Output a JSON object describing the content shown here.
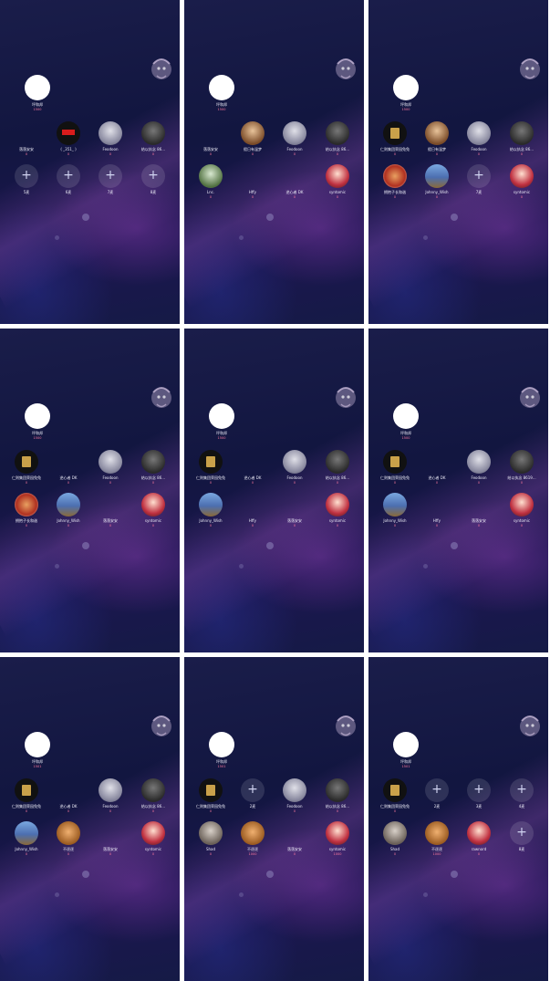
{
  "screens": [
    {
      "host": {
        "name": "坪和邦",
        "badge": "1500"
      },
      "seats": [
        {
          "name": "落落安安",
          "badge": "0",
          "avatar": "ghost",
          "empty": false
        },
        {
          "name": "( _351_ )",
          "badge": "0",
          "avatar": "red",
          "empty": false
        },
        {
          "name": "Feodoon",
          "badge": "0",
          "avatar": "silver",
          "empty": false
        },
        {
          "name": "结以执念 86...",
          "badge": "0",
          "avatar": "dark",
          "empty": false
        },
        {
          "name": "5麦",
          "badge": "",
          "avatar": "",
          "empty": true
        },
        {
          "name": "6麦",
          "badge": "",
          "avatar": "",
          "empty": true
        },
        {
          "name": "7麦",
          "badge": "",
          "avatar": "",
          "empty": true
        },
        {
          "name": "8麦",
          "badge": "",
          "avatar": "",
          "empty": true
        }
      ]
    },
    {
      "host": {
        "name": "坪和邦",
        "badge": "1500"
      },
      "seats": [
        {
          "name": "落落安安",
          "badge": "0",
          "avatar": "ghost",
          "empty": false
        },
        {
          "name": "假日有温梦",
          "badge": "0",
          "avatar": "brown",
          "empty": false
        },
        {
          "name": "Feodoon",
          "badge": "0",
          "avatar": "silver",
          "empty": false
        },
        {
          "name": "结以执念 86...",
          "badge": "0",
          "avatar": "dark",
          "empty": false
        },
        {
          "name": "Lnc.",
          "badge": "0",
          "avatar": "green",
          "empty": false
        },
        {
          "name": "Hffy",
          "badge": "0",
          "avatar": "ghost",
          "empty": false
        },
        {
          "name": "逆心者 DK",
          "badge": "0",
          "avatar": "ghost",
          "empty": false
        },
        {
          "name": "syntomic",
          "badge": "0",
          "avatar": "mix",
          "empty": false
        }
      ]
    },
    {
      "host": {
        "name": "坪和邦",
        "badge": "1500"
      },
      "seats": [
        {
          "name": "仁则集团荣园兔兔",
          "badge": "0",
          "avatar": "gold",
          "empty": false
        },
        {
          "name": "假日有温梦",
          "badge": "0",
          "avatar": "brown",
          "empty": false
        },
        {
          "name": "Feodoon",
          "badge": "0",
          "avatar": "silver",
          "empty": false
        },
        {
          "name": "结以执念 86...",
          "badge": "0",
          "avatar": "dark",
          "empty": false
        },
        {
          "name": "拥抱子长和谐",
          "badge": "0",
          "avatar": "gift",
          "empty": false
        },
        {
          "name": "Johnny_Wish",
          "badge": "0",
          "avatar": "sky",
          "empty": false
        },
        {
          "name": "7麦",
          "badge": "",
          "avatar": "",
          "empty": true
        },
        {
          "name": "syntomic",
          "badge": "0",
          "avatar": "mix",
          "empty": false
        }
      ]
    },
    {
      "host": {
        "name": "坪和邦",
        "badge": "1500"
      },
      "seats": [
        {
          "name": "仁则集团荣园兔兔",
          "badge": "0",
          "avatar": "gold",
          "empty": false
        },
        {
          "name": "逆心者 DK",
          "badge": "0",
          "avatar": "ghost",
          "empty": false
        },
        {
          "name": "Feodoon",
          "badge": "0",
          "avatar": "silver",
          "empty": false
        },
        {
          "name": "结以执念 86...",
          "badge": "0",
          "avatar": "dark",
          "empty": false
        },
        {
          "name": "拥抱子长和谐",
          "badge": "0",
          "avatar": "gift",
          "empty": false
        },
        {
          "name": "Johnny_Wish",
          "badge": "0",
          "avatar": "sky",
          "empty": false
        },
        {
          "name": "落落安安",
          "badge": "0",
          "avatar": "ghost",
          "empty": false
        },
        {
          "name": "syntomic",
          "badge": "0",
          "avatar": "mix",
          "empty": false
        }
      ]
    },
    {
      "host": {
        "name": "坪和邦",
        "badge": "1500"
      },
      "seats": [
        {
          "name": "仁则集团荣园兔兔",
          "badge": "0",
          "avatar": "gold",
          "empty": false
        },
        {
          "name": "逆心者 DK",
          "badge": "0",
          "avatar": "ghost",
          "empty": false
        },
        {
          "name": "Feodoon",
          "badge": "0",
          "avatar": "silver",
          "empty": false
        },
        {
          "name": "结以执念 86...",
          "badge": "0",
          "avatar": "dark",
          "empty": false
        },
        {
          "name": "Johnny_Wish",
          "badge": "0",
          "avatar": "sky",
          "empty": false
        },
        {
          "name": "Hffy",
          "badge": "0",
          "avatar": "ghost",
          "empty": false
        },
        {
          "name": "落落安安",
          "badge": "0",
          "avatar": "ghost",
          "empty": false
        },
        {
          "name": "syntomic",
          "badge": "0",
          "avatar": "mix",
          "empty": false
        }
      ]
    },
    {
      "host": {
        "name": "坪和邦",
        "badge": "1500"
      },
      "seats": [
        {
          "name": "仁则集团荣园兔兔",
          "badge": "0",
          "avatar": "gold",
          "empty": false
        },
        {
          "name": "逆心者 DK",
          "badge": "0",
          "avatar": "ghost",
          "empty": false
        },
        {
          "name": "Feodoon",
          "badge": "0",
          "avatar": "silver",
          "empty": false
        },
        {
          "name": "结以执念 8619...",
          "badge": "0",
          "avatar": "dark",
          "empty": false
        },
        {
          "name": "Johnny_Wish",
          "badge": "0",
          "avatar": "sky",
          "empty": false
        },
        {
          "name": "Hffy",
          "badge": "0",
          "avatar": "ghost",
          "empty": false
        },
        {
          "name": "落落安安",
          "badge": "0",
          "avatar": "ghost",
          "empty": false
        },
        {
          "name": "syntomic",
          "badge": "0",
          "avatar": "mix",
          "empty": false
        }
      ]
    },
    {
      "host": {
        "name": "坪和邦",
        "badge": "1501"
      },
      "seats": [
        {
          "name": "仁则集团荣园兔兔",
          "badge": "0",
          "avatar": "gold",
          "empty": false
        },
        {
          "name": "逆心者 DK",
          "badge": "0",
          "avatar": "ghost",
          "empty": false
        },
        {
          "name": "Feodoon",
          "badge": "0",
          "avatar": "silver",
          "empty": false
        },
        {
          "name": "结以执念 86...",
          "badge": "0",
          "avatar": "dark",
          "empty": false
        },
        {
          "name": "Johnny_Wish",
          "badge": "0",
          "avatar": "sky",
          "empty": false
        },
        {
          "name": "不逐逐",
          "badge": "0",
          "avatar": "warm",
          "empty": false
        },
        {
          "name": "落落安安",
          "badge": "0",
          "avatar": "ghost",
          "empty": false
        },
        {
          "name": "syntomic",
          "badge": "0",
          "avatar": "mix",
          "empty": false
        }
      ]
    },
    {
      "host": {
        "name": "坪和邦",
        "badge": "1501"
      },
      "seats": [
        {
          "name": "仁则集团荣园兔兔",
          "badge": "0",
          "avatar": "gold",
          "empty": false
        },
        {
          "name": "2麦",
          "badge": "",
          "avatar": "",
          "empty": true
        },
        {
          "name": "Feodoon",
          "badge": "0",
          "avatar": "silver",
          "empty": false
        },
        {
          "name": "结以执念 86...",
          "badge": "0",
          "avatar": "dark",
          "empty": false
        },
        {
          "name": "Shad",
          "badge": "0",
          "avatar": "gray",
          "empty": false
        },
        {
          "name": "不逐逐",
          "badge": "1000",
          "avatar": "warm",
          "empty": false
        },
        {
          "name": "落落安安",
          "badge": "0",
          "avatar": "ghost",
          "empty": false
        },
        {
          "name": "syntomic",
          "badge": "1000",
          "avatar": "mix",
          "empty": false
        }
      ]
    },
    {
      "host": {
        "name": "坪和邦",
        "badge": "1501"
      },
      "seats": [
        {
          "name": "仁则集团荣园兔兔",
          "badge": "0",
          "avatar": "gold",
          "empty": false
        },
        {
          "name": "2麦",
          "badge": "",
          "avatar": "",
          "empty": true
        },
        {
          "name": "3麦",
          "badge": "",
          "avatar": "",
          "empty": true
        },
        {
          "name": "4麦",
          "badge": "",
          "avatar": "",
          "empty": true
        },
        {
          "name": "Shad",
          "badge": "0",
          "avatar": "gray",
          "empty": false
        },
        {
          "name": "不逐逐",
          "badge": "1000",
          "avatar": "warm",
          "empty": false
        },
        {
          "name": "rawnord",
          "badge": "0",
          "avatar": "mix",
          "empty": false
        },
        {
          "name": "8麦",
          "badge": "",
          "avatar": "",
          "empty": true
        }
      ]
    }
  ]
}
